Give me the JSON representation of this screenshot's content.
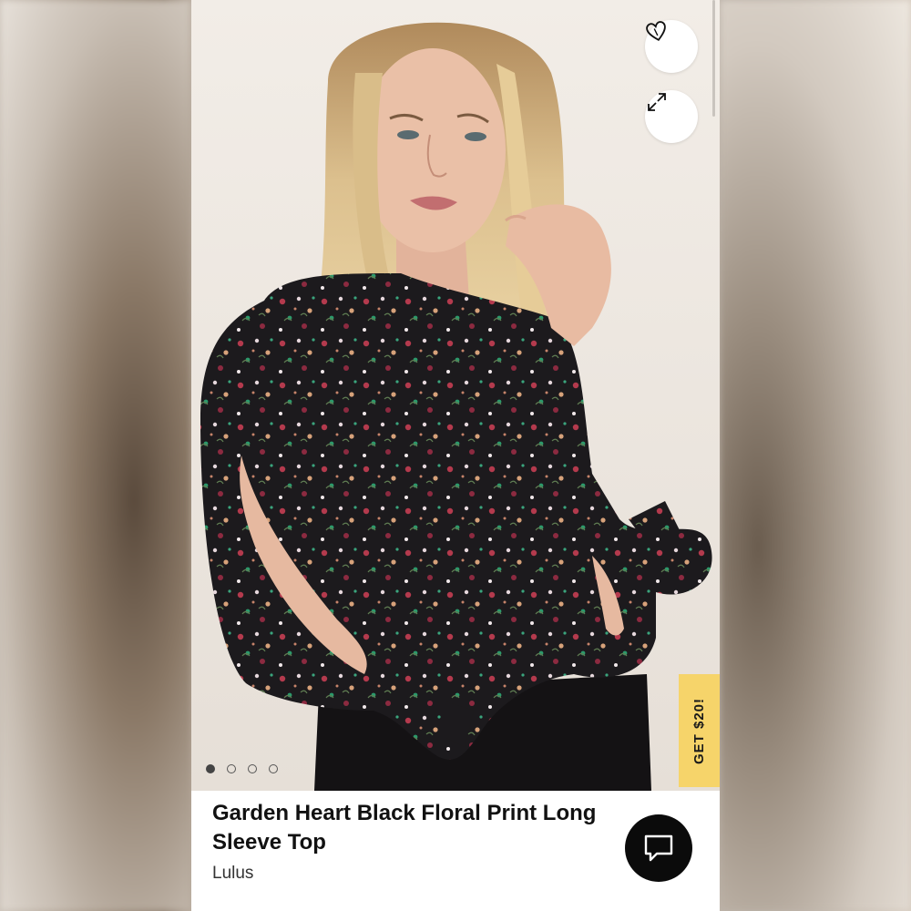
{
  "product": {
    "title": "Garden Heart Black Floral Print Long Sleeve Top",
    "brand": "Lulus"
  },
  "gallery": {
    "slide_count": 4,
    "active_slide": 1,
    "image_description_icon": "model-wearing-floral-top"
  },
  "actions": {
    "favorite_icon": "heart-icon",
    "expand_icon": "expand-icon",
    "chat_icon": "chat-bubble-icon"
  },
  "promo": {
    "label": "GET $20!"
  },
  "colors": {
    "promo_bg": "#f6d46a",
    "chat_bg": "#0b0b0b",
    "top_fabric": "#1c1a1d"
  }
}
